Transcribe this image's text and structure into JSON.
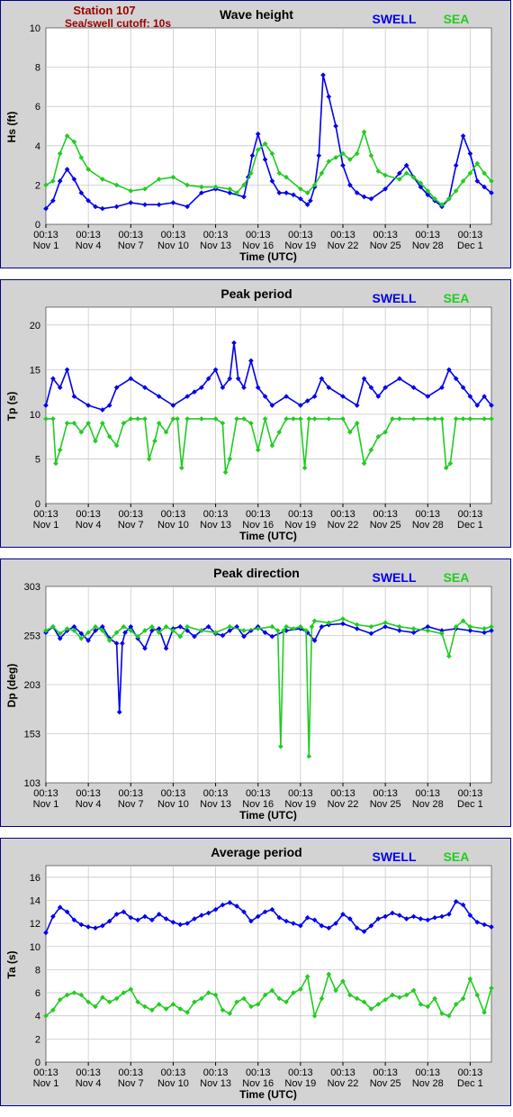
{
  "header": {
    "station": "Station 107",
    "cutoff": "Sea/swell cutoff: 10s"
  },
  "legend": {
    "swell": "SWELL",
    "sea": "SEA"
  },
  "colors": {
    "swell": "#0000ee",
    "sea": "#22cc22",
    "header": "#990000",
    "frame": "#00008b",
    "background": "#d3d3d3"
  },
  "x_axis": {
    "label": "Time (UTC)",
    "tick_time": "00:13",
    "ticks": [
      "Nov 1",
      "Nov 4",
      "Nov 7",
      "Nov 10",
      "Nov 13",
      "Nov 16",
      "Nov 19",
      "Nov 22",
      "Nov 25",
      "Nov 28",
      "Dec 1"
    ]
  },
  "chart_data": [
    {
      "type": "line",
      "title": "Wave height",
      "ylabel": "Hs (ft)",
      "ylim": [
        0,
        10
      ],
      "yticks": [
        0,
        2,
        4,
        6,
        8,
        10
      ],
      "xlim": [
        0,
        31.5
      ],
      "grid": true,
      "legend": "top-right",
      "series": [
        {
          "name": "SWELL",
          "x": [
            0,
            0.5,
            1,
            1.5,
            2,
            2.5,
            3,
            3.5,
            4,
            5,
            6,
            7,
            8,
            9,
            10,
            11,
            12,
            13,
            14,
            14.3,
            14.6,
            15,
            15.5,
            16,
            16.5,
            17,
            17.5,
            18,
            18.5,
            18.7,
            19,
            19.3,
            19.6,
            20,
            20.5,
            21,
            21.5,
            22,
            22.5,
            23,
            24,
            25,
            25.5,
            26,
            26.5,
            27,
            27.5,
            28,
            28.5,
            29,
            29.5,
            30,
            30.5,
            31,
            31.5
          ],
          "values": [
            0.8,
            1.2,
            2.2,
            2.8,
            2.3,
            1.6,
            1.2,
            0.9,
            0.8,
            0.9,
            1.1,
            1.0,
            1.0,
            1.1,
            0.9,
            1.6,
            1.8,
            1.6,
            1.4,
            2.4,
            3.5,
            4.6,
            3.3,
            2.2,
            1.6,
            1.6,
            1.5,
            1.3,
            1.0,
            1.2,
            1.9,
            3.5,
            7.6,
            6.5,
            5.0,
            3.0,
            2.0,
            1.6,
            1.4,
            1.3,
            1.8,
            2.6,
            3.0,
            2.4,
            1.9,
            1.5,
            1.2,
            0.9,
            1.3,
            3.0,
            4.5,
            3.6,
            2.2,
            1.9,
            1.6
          ]
        },
        {
          "name": "SEA",
          "x": [
            0,
            0.5,
            1,
            1.5,
            2,
            2.5,
            3,
            4,
            5,
            6,
            7,
            8,
            9,
            10,
            11,
            12,
            13,
            13.5,
            14,
            14.5,
            15,
            15.5,
            16,
            16.5,
            17,
            18,
            18.5,
            19,
            19.5,
            20,
            20.5,
            21,
            21.5,
            22,
            22.5,
            23,
            23.5,
            24,
            25,
            25.5,
            26,
            26.5,
            27,
            27.5,
            28,
            28.5,
            29,
            29.5,
            30,
            30.5,
            31,
            31.5
          ],
          "values": [
            2.0,
            2.2,
            3.6,
            4.5,
            4.2,
            3.4,
            2.8,
            2.3,
            2.0,
            1.7,
            1.8,
            2.3,
            2.4,
            2.0,
            1.9,
            1.9,
            1.8,
            1.6,
            2.0,
            2.6,
            3.8,
            4.1,
            3.6,
            2.6,
            2.4,
            1.8,
            1.6,
            2.0,
            2.6,
            3.2,
            3.4,
            3.6,
            3.3,
            3.6,
            4.7,
            3.5,
            2.7,
            2.5,
            2.3,
            2.6,
            2.4,
            2.1,
            1.7,
            1.3,
            1.0,
            1.3,
            1.7,
            2.2,
            2.6,
            3.1,
            2.6,
            2.2
          ]
        }
      ]
    },
    {
      "type": "line",
      "title": "Peak period",
      "ylabel": "Tp (s)",
      "ylim": [
        0,
        22
      ],
      "yticks": [
        0,
        5,
        10,
        15,
        20
      ],
      "xlim": [
        0,
        31.5
      ],
      "grid": true,
      "legend": "top-right",
      "series": [
        {
          "name": "SWELL",
          "x": [
            0,
            0.5,
            1,
            1.5,
            2,
            3,
            4,
            4.5,
            5,
            6,
            7,
            8,
            9,
            10,
            10.5,
            11,
            11.5,
            12,
            12.5,
            13,
            13.3,
            13.6,
            14,
            14.5,
            15,
            15.5,
            16,
            17,
            18,
            18.5,
            19,
            19.5,
            20,
            21,
            22,
            22.5,
            23,
            23.5,
            24,
            25,
            26,
            27,
            28,
            28.5,
            29,
            29.5,
            30,
            30.5,
            31,
            31.5
          ],
          "values": [
            11,
            14,
            13,
            15,
            12,
            11,
            10.5,
            11,
            13,
            14,
            13,
            12,
            11,
            12,
            12.5,
            13,
            14,
            15,
            13,
            14,
            18,
            14,
            13,
            16,
            13,
            12,
            11,
            12,
            11,
            11.5,
            12,
            14,
            13,
            12,
            11,
            14,
            13,
            12,
            13,
            14,
            13,
            12,
            13,
            15,
            14,
            13,
            12,
            11,
            12,
            11
          ]
        },
        {
          "name": "SEA",
          "x": [
            0,
            0.5,
            0.7,
            1,
            1.5,
            2,
            2.5,
            3,
            3.5,
            4,
            4.5,
            5,
            5.5,
            6,
            6.5,
            7,
            7.3,
            7.7,
            8,
            8.5,
            9,
            9.3,
            9.6,
            10,
            11,
            12,
            12.5,
            12.7,
            13,
            13.5,
            14,
            14.5,
            15,
            15.5,
            16,
            16.5,
            17,
            17.5,
            18,
            18.3,
            18.6,
            19,
            20,
            21,
            21.5,
            22,
            22.5,
            23,
            23.5,
            24,
            24.5,
            25,
            26,
            27,
            27.5,
            28,
            28.3,
            28.6,
            29,
            29.5,
            30,
            31,
            31.5
          ],
          "values": [
            9.5,
            9.5,
            4.5,
            6,
            9,
            9,
            8,
            9,
            7,
            9,
            7.5,
            6.5,
            9,
            9.5,
            9.5,
            9.5,
            5,
            7,
            9,
            8,
            9.5,
            9.5,
            4,
            9.5,
            9.5,
            9.5,
            9,
            3.5,
            5,
            9.5,
            9.5,
            9,
            6,
            9.5,
            6.5,
            8,
            9.5,
            9.5,
            9.5,
            4,
            9.5,
            9.5,
            9.5,
            9.5,
            8,
            9,
            4.5,
            6,
            7.5,
            8,
            9.5,
            9.5,
            9.5,
            9.5,
            9.5,
            9.5,
            4,
            4.5,
            9.5,
            9.5,
            9.5,
            9.5,
            9.5
          ]
        }
      ]
    },
    {
      "type": "line",
      "title": "Peak direction",
      "ylabel": "Dp (deg)",
      "ylim": [
        103,
        303
      ],
      "yticks": [
        103,
        153,
        203,
        253,
        303
      ],
      "xlim": [
        0,
        31.5
      ],
      "grid": true,
      "legend": "top-right",
      "series": [
        {
          "name": "SWELL",
          "x": [
            0,
            0.5,
            1,
            1.5,
            2,
            2.5,
            3,
            3.5,
            4,
            4.5,
            5,
            5.2,
            5.4,
            5.6,
            6,
            6.5,
            7,
            7.5,
            8,
            8.5,
            9,
            9.5,
            10,
            10.5,
            11,
            11.5,
            12,
            12.5,
            13,
            13.5,
            14,
            14.5,
            15,
            15.5,
            16,
            17,
            18,
            18.5,
            19,
            19.5,
            20,
            21,
            22,
            23,
            24,
            25,
            26,
            27,
            28,
            29,
            30,
            31,
            31.5
          ],
          "values": [
            256,
            262,
            250,
            258,
            262,
            255,
            248,
            258,
            262,
            250,
            245,
            175,
            245,
            256,
            262,
            250,
            240,
            258,
            260,
            240,
            260,
            262,
            258,
            252,
            258,
            262,
            255,
            253,
            258,
            262,
            252,
            258,
            262,
            256,
            252,
            258,
            260,
            256,
            248,
            262,
            264,
            265,
            260,
            255,
            262,
            258,
            256,
            262,
            258,
            260,
            258,
            256,
            258
          ]
        },
        {
          "name": "SEA",
          "x": [
            0,
            0.5,
            1,
            1.5,
            2,
            2.5,
            3,
            3.5,
            4,
            4.5,
            5,
            5.5,
            6,
            6.5,
            7,
            7.5,
            8,
            8.5,
            9,
            9.5,
            10,
            11,
            12,
            13,
            14,
            15,
            16,
            16.4,
            16.6,
            16.8,
            17,
            17.5,
            18,
            18.4,
            18.6,
            18.8,
            19,
            20,
            21,
            22,
            23,
            24,
            25,
            26,
            27,
            28,
            28.5,
            29,
            29.5,
            30,
            31,
            31.5
          ],
          "values": [
            258,
            262,
            255,
            260,
            258,
            250,
            256,
            262,
            258,
            248,
            256,
            262,
            258,
            252,
            258,
            262,
            256,
            262,
            258,
            252,
            262,
            258,
            256,
            262,
            258,
            260,
            262,
            258,
            140,
            258,
            262,
            260,
            262,
            258,
            130,
            262,
            268,
            266,
            270,
            264,
            262,
            266,
            262,
            260,
            258,
            255,
            232,
            262,
            268,
            262,
            260,
            262
          ]
        }
      ]
    },
    {
      "type": "line",
      "title": "Average period",
      "ylabel": "Ta (s)",
      "ylim": [
        0,
        17
      ],
      "yticks": [
        0,
        2,
        4,
        6,
        8,
        10,
        12,
        14,
        16
      ],
      "xlim": [
        0,
        31.5
      ],
      "grid": true,
      "legend": "top-right",
      "series": [
        {
          "name": "SWELL",
          "x": [
            0,
            0.5,
            1,
            1.5,
            2,
            2.5,
            3,
            3.5,
            4,
            4.5,
            5,
            5.5,
            6,
            6.5,
            7,
            7.5,
            8,
            8.5,
            9,
            9.5,
            10,
            10.5,
            11,
            11.5,
            12,
            12.5,
            13,
            13.5,
            14,
            14.5,
            15,
            15.5,
            16,
            16.5,
            17,
            17.5,
            18,
            18.5,
            19,
            19.5,
            20,
            20.5,
            21,
            21.5,
            22,
            22.5,
            23,
            23.5,
            24,
            24.5,
            25,
            25.5,
            26,
            26.5,
            27,
            27.5,
            28,
            28.5,
            29,
            29.5,
            30,
            30.5,
            31,
            31.5
          ],
          "values": [
            11.2,
            12.6,
            13.4,
            13.0,
            12.3,
            11.9,
            11.7,
            11.6,
            11.8,
            12.2,
            12.8,
            13.0,
            12.5,
            12.3,
            12.6,
            12.3,
            12.8,
            12.4,
            12.1,
            11.9,
            12.0,
            12.4,
            12.7,
            12.9,
            13.2,
            13.6,
            13.8,
            13.5,
            13.0,
            12.2,
            12.6,
            13.0,
            13.2,
            12.5,
            12.2,
            12.0,
            11.8,
            12.5,
            12.3,
            11.8,
            11.6,
            12.0,
            12.8,
            12.4,
            11.6,
            11.3,
            11.8,
            12.4,
            12.6,
            12.9,
            12.7,
            12.4,
            12.6,
            12.4,
            12.3,
            12.5,
            12.6,
            12.8,
            13.9,
            13.6,
            12.7,
            12.1,
            11.9,
            11.7
          ]
        },
        {
          "name": "SEA",
          "x": [
            0,
            0.5,
            1,
            1.5,
            2,
            2.5,
            3,
            3.5,
            4,
            4.5,
            5,
            5.5,
            6,
            6.5,
            7,
            7.5,
            8,
            8.5,
            9,
            9.5,
            10,
            10.5,
            11,
            11.5,
            12,
            12.5,
            13,
            13.5,
            14,
            14.5,
            15,
            15.5,
            16,
            16.5,
            17,
            17.5,
            18,
            18.5,
            19,
            19.5,
            20,
            20.5,
            21,
            21.5,
            22,
            22.5,
            23,
            23.5,
            24,
            24.5,
            25,
            25.5,
            26,
            26.5,
            27,
            27.5,
            28,
            28.5,
            29,
            29.5,
            30,
            30.5,
            31,
            31.5
          ],
          "values": [
            4.0,
            4.5,
            5.4,
            5.8,
            6.0,
            5.8,
            5.2,
            4.8,
            5.6,
            5.2,
            5.5,
            6.0,
            6.3,
            5.2,
            4.8,
            4.5,
            5.0,
            4.6,
            5.0,
            4.6,
            4.3,
            5.2,
            5.5,
            6.0,
            5.8,
            4.5,
            4.2,
            5.2,
            5.5,
            4.8,
            5.0,
            5.8,
            6.2,
            5.5,
            5.2,
            6.0,
            6.3,
            7.4,
            4.0,
            5.5,
            7.6,
            6.2,
            7.0,
            5.8,
            5.5,
            5.2,
            4.6,
            5.0,
            5.4,
            5.8,
            5.6,
            5.8,
            6.2,
            5.0,
            4.8,
            5.5,
            4.2,
            4.0,
            5.0,
            5.5,
            7.2,
            5.8,
            4.3,
            6.4
          ]
        }
      ]
    }
  ]
}
